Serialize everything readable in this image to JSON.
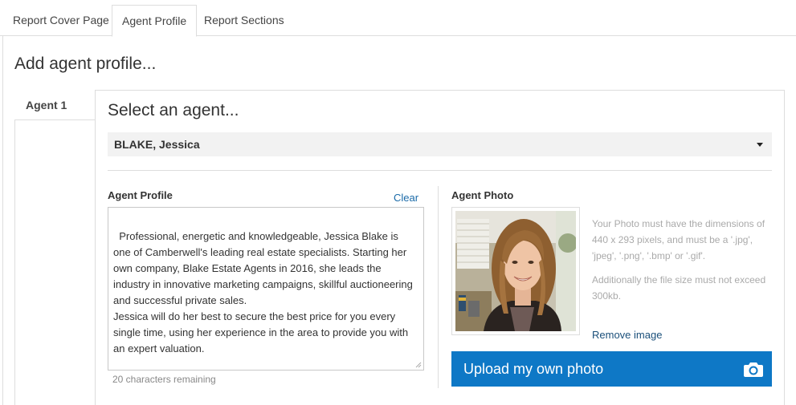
{
  "tabs": [
    {
      "label": "Report Cover Page",
      "active": false
    },
    {
      "label": "Agent Profile",
      "active": true
    },
    {
      "label": "Report Sections",
      "active": false
    }
  ],
  "page_title": "Add agent profile...",
  "agent_tab": {
    "label": "Agent 1"
  },
  "select_heading": "Select an agent...",
  "agent_select": {
    "value": "BLAKE, Jessica",
    "icon": "caret-down-icon"
  },
  "profile": {
    "label": "Agent Profile",
    "clear_label": "Clear",
    "text": "Professional, energetic and knowledgeable, Jessica Blake is one of Camberwell's leading real estate specialists. Starting her own company, Blake Estate Agents in 2016, she leads the industry in innovative marketing campaigns, skillful auctioneering and successful private sales.\nJessica will do her best to secure the best price for you every single time, using her experience in the area to provide you with an expert valuation.",
    "chars_remaining": "20 characters remaining"
  },
  "photo": {
    "label": "Agent Photo",
    "help_1": "Your Photo must have the dimensions of 440 x 293 pixels, and must be a '.jpg', 'jpeg', '.png', '.bmp' or '.gif'.",
    "help_2": "Additionally the file size must not exceed 300kb.",
    "remove_label": "Remove image",
    "upload_label": "Upload my own photo",
    "upload_icon": "camera-icon"
  },
  "colors": {
    "accent": "#0e78c6",
    "link": "#1a6aa8",
    "border": "#dddddd",
    "select_bg": "#f2f2f2"
  }
}
